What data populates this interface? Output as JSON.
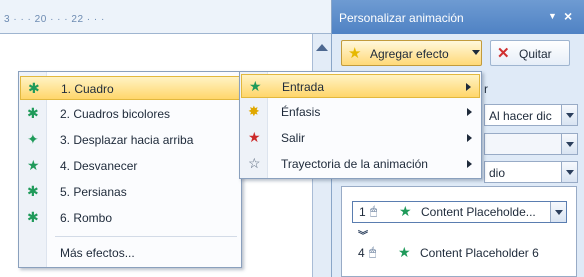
{
  "ruler": {
    "text": "3 · · · 20 · · · 22 · · ·"
  },
  "task_pane": {
    "title": "Personalizar animación",
    "add_effect_label": "Agregar efecto",
    "remove_label": "Quitar",
    "start_value": "Al hacer dic",
    "direction_value": "",
    "speed_value": "dio",
    "label_fragment": "r",
    "animation_list": [
      {
        "number": "1",
        "label": "Content Placeholde..."
      },
      {
        "number": "4",
        "label": "Content Placeholder 6"
      }
    ]
  },
  "submenu_effect_types": [
    {
      "label": "Entrada",
      "icon": "green-star-icon"
    },
    {
      "label": "Énfasis",
      "icon": "yellow-star-icon"
    },
    {
      "label": "Salir",
      "icon": "red-star-icon"
    },
    {
      "label": "Trayectoria de la animación",
      "icon": "outline-star-icon"
    }
  ],
  "entrance_menu": [
    {
      "label": "1. Cuadro",
      "icon": "box-effect-icon",
      "highlighted": true
    },
    {
      "label": "2. Cuadros bicolores",
      "icon": "checkerboard-effect-icon"
    },
    {
      "label": "3. Desplazar hacia arriba",
      "icon": "crawl-in-effect-icon"
    },
    {
      "label": "4. Desvanecer",
      "icon": "fade-effect-icon"
    },
    {
      "label": "5. Persianas",
      "icon": "blinds-effect-icon"
    },
    {
      "label": "6. Rombo",
      "icon": "diamond-effect-icon"
    },
    {
      "label": "Más efectos...",
      "icon": ""
    }
  ],
  "colors": {
    "pane_header": "#5a8ccb",
    "highlight": "#ffd66b",
    "entrance_icon": "#1f9a5a",
    "emphasis_icon": "#e0a800",
    "exit_icon": "#cc2a2a"
  }
}
